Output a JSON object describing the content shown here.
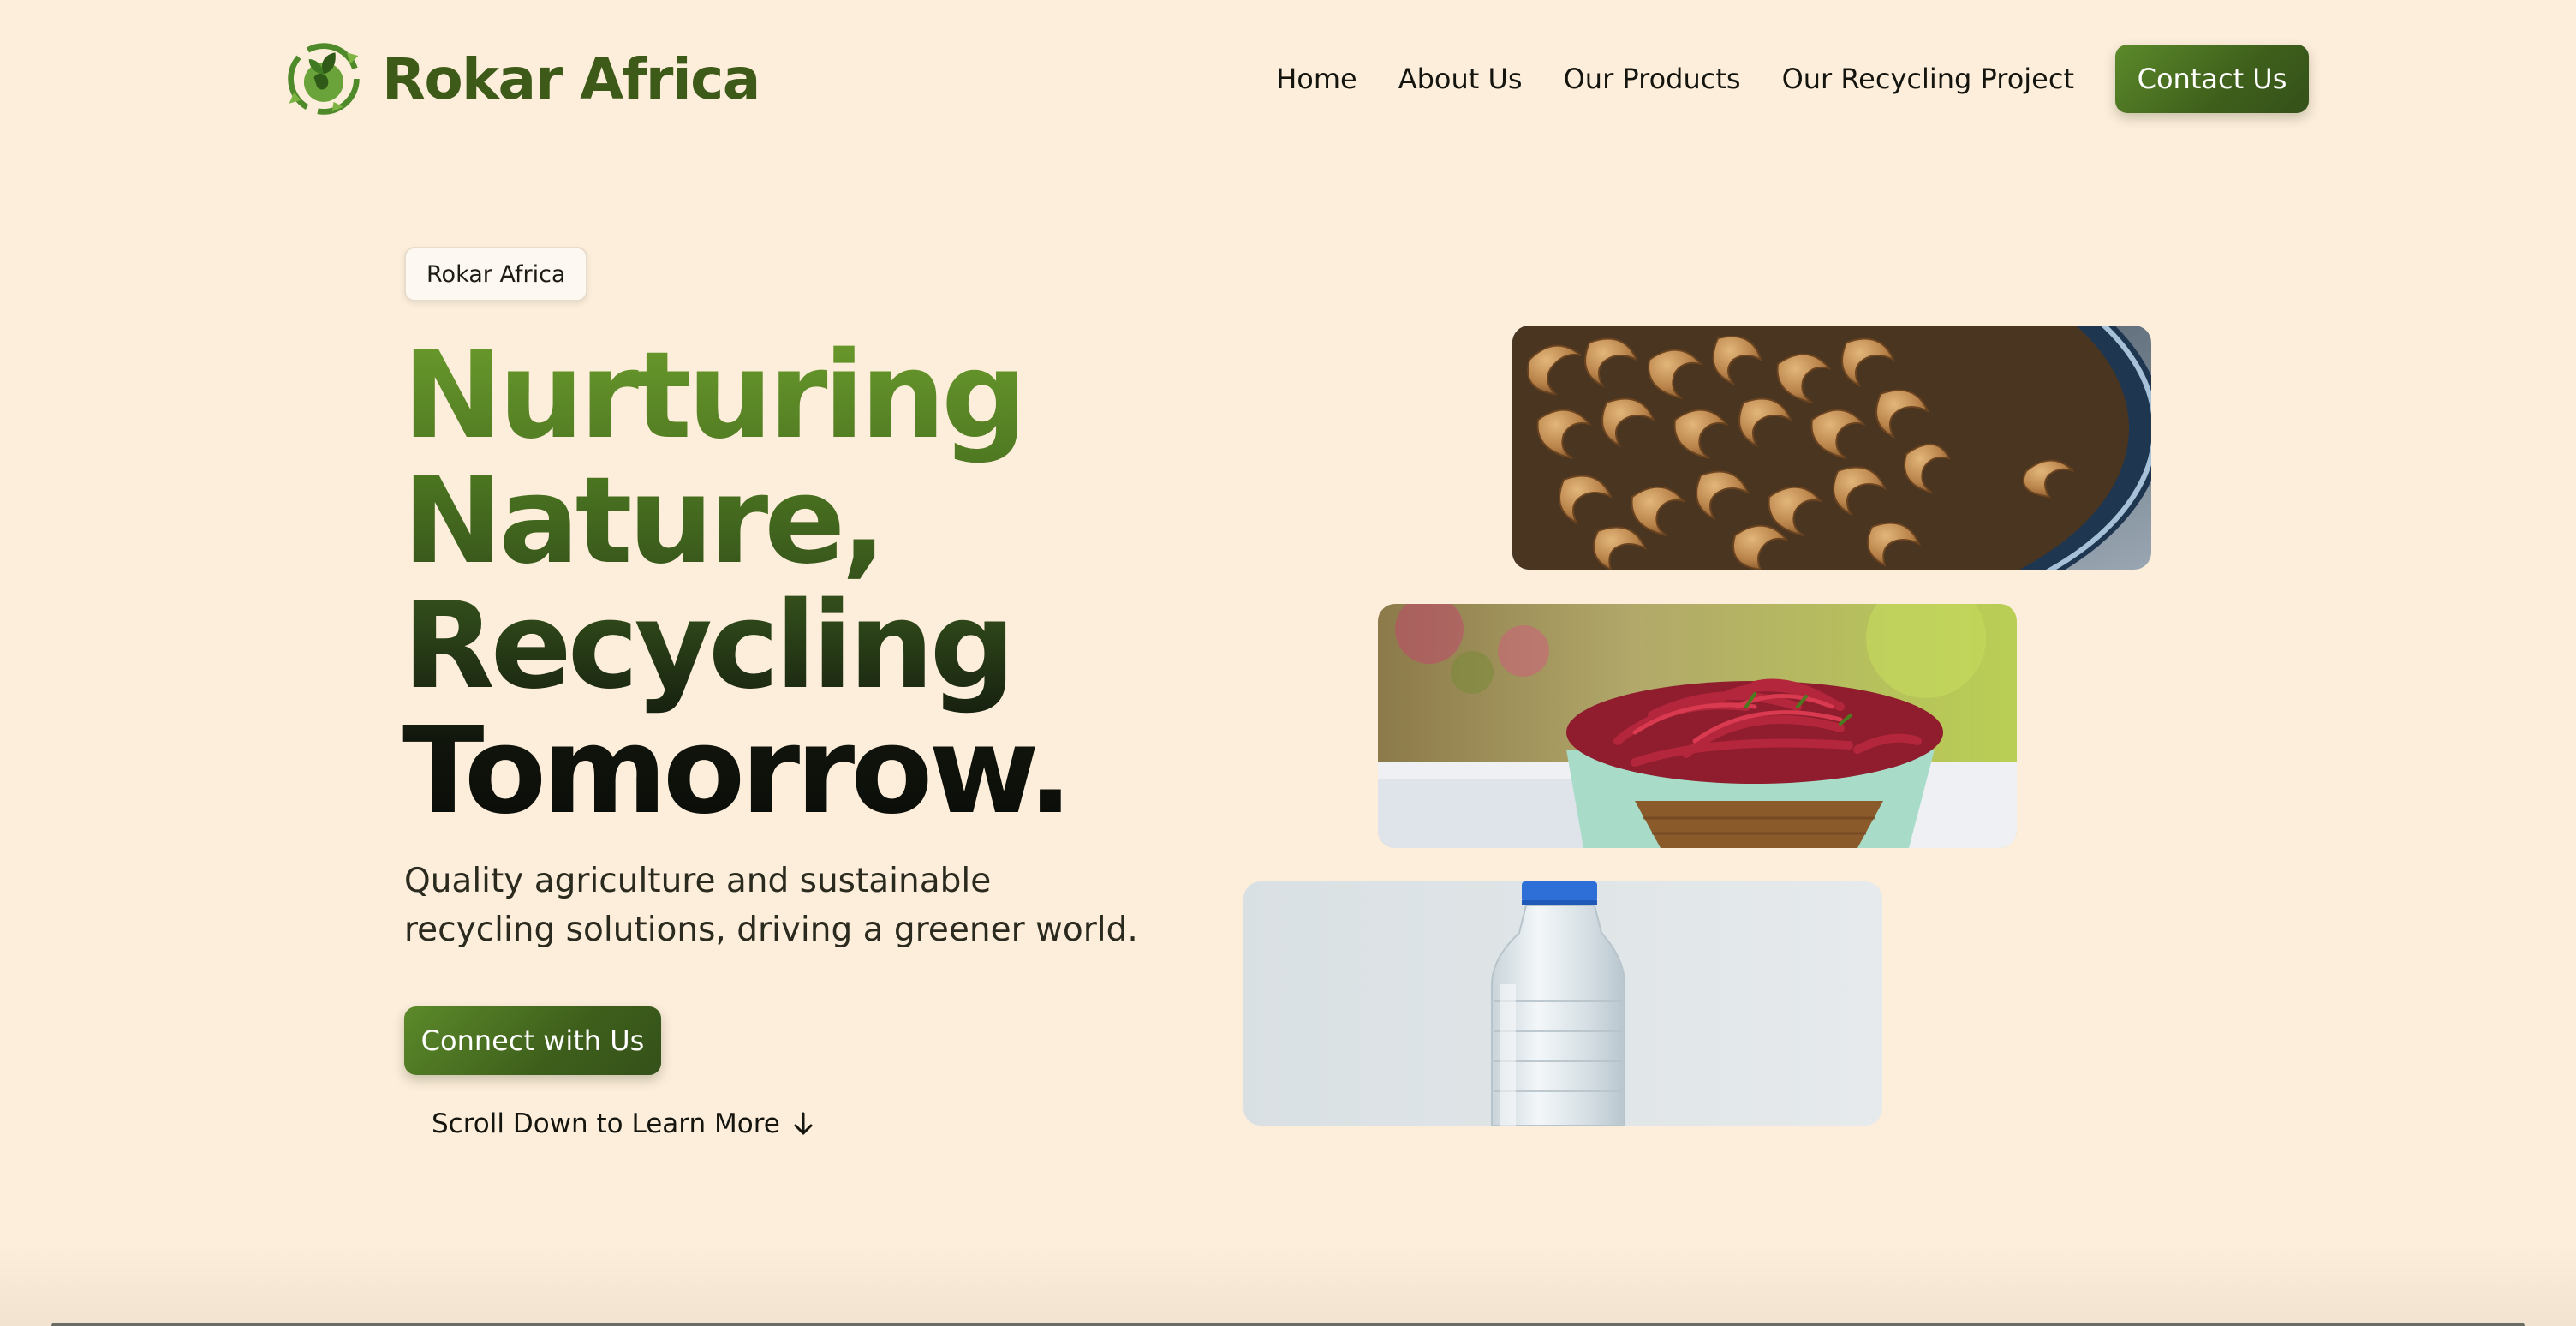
{
  "brand": {
    "name": "Rokar Africa",
    "logo_icon": "recycle-leaf-globe-icon",
    "primary_color": "#3e5f1b",
    "accent_color": "#6a9a2c",
    "background_color": "#fdeedb"
  },
  "nav": {
    "items": [
      {
        "label": "Home"
      },
      {
        "label": "About Us"
      },
      {
        "label": "Our Products"
      },
      {
        "label": "Our Recycling Project"
      }
    ],
    "cta_label": "Contact Us"
  },
  "hero": {
    "badge": "Rokar Africa",
    "headline": [
      "Nurturing",
      "Nature,",
      "Recycling",
      "Tomorrow."
    ],
    "subtitle": "Quality agriculture and sustainable recycling solutions, driving a greener world.",
    "cta_label": "Connect with Us",
    "scroll_label": "Scroll Down to Learn More",
    "scroll_icon": "arrow-down-icon"
  },
  "images": [
    {
      "subject": "cashews-bowl"
    },
    {
      "subject": "red-chillies-basket"
    },
    {
      "subject": "plastic-water-bottle"
    }
  ]
}
